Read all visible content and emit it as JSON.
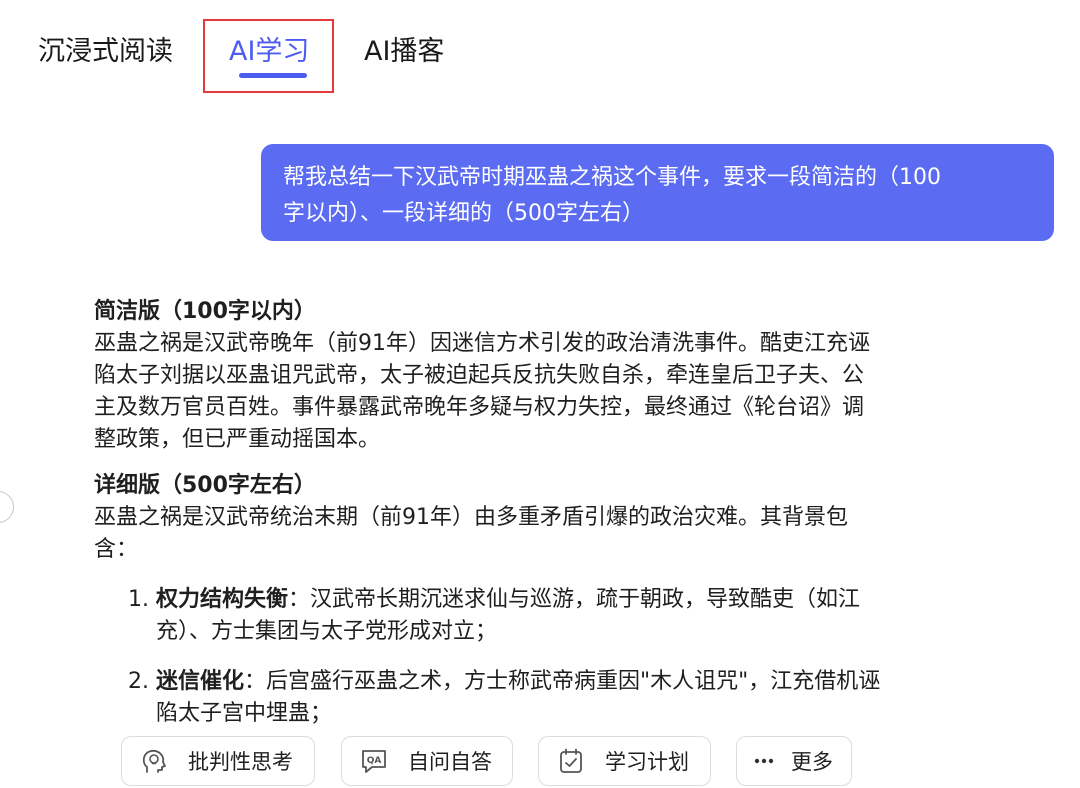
{
  "tabs": {
    "immersive_reading": "沉浸式阅读",
    "ai_learning": "AI学习",
    "ai_podcast": "AI播客",
    "active": "ai_learning"
  },
  "colors": {
    "accent": "#4d5cf0",
    "user_bubble": "#5b6bf2",
    "highlight_box": "#e23b3b"
  },
  "chat": {
    "user_message_line1": "帮我总结一下汉武帝时期巫蛊之祸这个事件，要求一段简洁的（100",
    "user_message_line2": "字以内）、一段详细的（500字左右）"
  },
  "answer": {
    "brief_title": "简洁版（100字以内）",
    "brief_text_l1": "巫蛊之祸是汉武帝晚年（前91年）因迷信方术引发的政治清洗事件。酷吏江充诬",
    "brief_text_l2": "陷太子刘据以巫蛊诅咒武帝，太子被迫起兵反抗失败自杀，牵连皇后卫子夫、公",
    "brief_text_l3": "主及数万官员百姓。事件暴露武帝晚年多疑与权力失控，最终通过《轮台诏》调",
    "brief_text_l4": "整政策，但已严重动摇国本。",
    "detail_title": "详细版（500字左右）",
    "detail_intro_l1": "巫蛊之祸是汉武帝统治末期（前91年）由多重矛盾引爆的政治灾难。其背景包",
    "detail_intro_l2": "含：",
    "items": [
      {
        "num": "1.",
        "bold": "权力结构失衡",
        "text_l1": "：汉武帝长期沉迷求仙与巡游，疏于朝政，导致酷吏（如江",
        "text_l2": "充）、方士集团与太子党形成对立；"
      },
      {
        "num": "2.",
        "bold": "迷信催化",
        "text_l1": "：后宫盛行巫蛊之术，方士称武帝病重因\"木人诅咒\"，江充借机诬",
        "text_l2": "陷太子宫中埋蛊；"
      }
    ]
  },
  "actions": {
    "critical_thinking": {
      "label": "批判性思考",
      "icon": "head-bulb-icon"
    },
    "self_qa": {
      "label": "自问自答",
      "icon": "qa-icon"
    },
    "study_plan": {
      "label": "学习计划",
      "icon": "plan-icon"
    },
    "more": {
      "label": "更多",
      "icon": "ellipsis-icon"
    }
  }
}
